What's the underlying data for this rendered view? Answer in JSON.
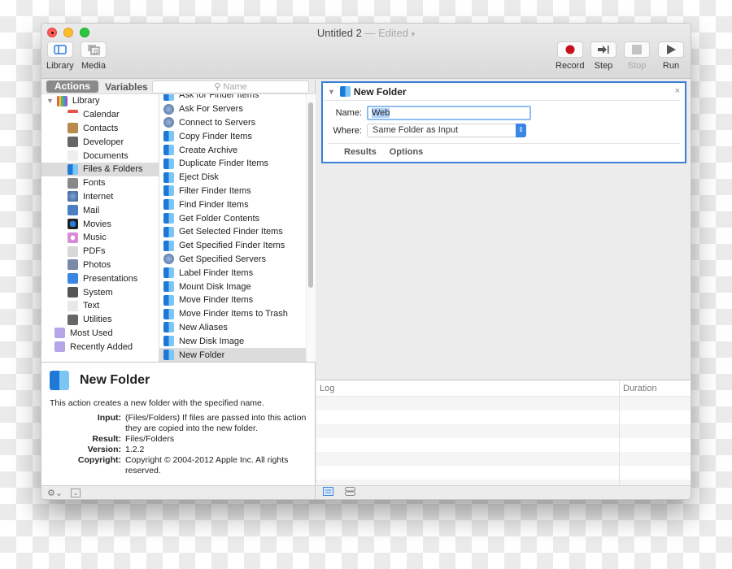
{
  "window": {
    "title": "Untitled 2",
    "title_separator": " — ",
    "title_status": "Edited",
    "title_chevron": "⌄"
  },
  "toolbar": {
    "library_label": "Library",
    "media_label": "Media",
    "record_label": "Record",
    "step_label": "Step",
    "stop_label": "Stop",
    "run_label": "Run",
    "colors": {
      "record": "#c8101c",
      "accent": "#3a7fd8"
    }
  },
  "tabs": {
    "actions": "Actions",
    "variables": "Variables"
  },
  "search": {
    "placeholder": "Name",
    "icon": "magnifier-icon"
  },
  "library": {
    "root": "Library",
    "items": [
      {
        "label": "Calendar",
        "icon": "calendar-icon"
      },
      {
        "label": "Contacts",
        "icon": "contacts-icon"
      },
      {
        "label": "Developer",
        "icon": "developer-icon"
      },
      {
        "label": "Documents",
        "icon": "documents-icon"
      },
      {
        "label": "Files & Folders",
        "icon": "finder-icon",
        "selected": true
      },
      {
        "label": "Fonts",
        "icon": "fonts-icon"
      },
      {
        "label": "Internet",
        "icon": "internet-icon"
      },
      {
        "label": "Mail",
        "icon": "mail-icon"
      },
      {
        "label": "Movies",
        "icon": "movies-icon"
      },
      {
        "label": "Music",
        "icon": "music-icon"
      },
      {
        "label": "PDFs",
        "icon": "pdf-icon"
      },
      {
        "label": "Photos",
        "icon": "photos-icon"
      },
      {
        "label": "Presentations",
        "icon": "presentations-icon"
      },
      {
        "label": "System",
        "icon": "system-icon"
      },
      {
        "label": "Text",
        "icon": "text-icon"
      },
      {
        "label": "Utilities",
        "icon": "utilities-icon"
      }
    ],
    "smart_groups": [
      {
        "label": "Most Used",
        "icon": "smart-folder-icon"
      },
      {
        "label": "Recently Added",
        "icon": "smart-folder-icon"
      }
    ]
  },
  "actions": [
    {
      "label": "Ask for Finder Items",
      "icon": "finder"
    },
    {
      "label": "Ask For Servers",
      "icon": "globe"
    },
    {
      "label": "Connect to Servers",
      "icon": "globe"
    },
    {
      "label": "Copy Finder Items",
      "icon": "finder"
    },
    {
      "label": "Create Archive",
      "icon": "finder"
    },
    {
      "label": "Duplicate Finder Items",
      "icon": "finder"
    },
    {
      "label": "Eject Disk",
      "icon": "finder"
    },
    {
      "label": "Filter Finder Items",
      "icon": "finder"
    },
    {
      "label": "Find Finder Items",
      "icon": "finder"
    },
    {
      "label": "Get Folder Contents",
      "icon": "finder"
    },
    {
      "label": "Get Selected Finder Items",
      "icon": "finder"
    },
    {
      "label": "Get Specified Finder Items",
      "icon": "finder"
    },
    {
      "label": "Get Specified Servers",
      "icon": "globe"
    },
    {
      "label": "Label Finder Items",
      "icon": "finder"
    },
    {
      "label": "Mount Disk Image",
      "icon": "finder"
    },
    {
      "label": "Move Finder Items",
      "icon": "finder"
    },
    {
      "label": "Move Finder Items to Trash",
      "icon": "finder"
    },
    {
      "label": "New Aliases",
      "icon": "finder"
    },
    {
      "label": "New Disk Image",
      "icon": "finder"
    },
    {
      "label": "New Folder",
      "icon": "finder",
      "selected": true
    }
  ],
  "description": {
    "title": "New Folder",
    "summary": "This action creates a new folder with the specified name.",
    "fields": [
      {
        "key": "Input:",
        "value": "(Files/Folders) If files are passed into this action they are copied into the new folder."
      },
      {
        "key": "Result:",
        "value": "Files/Folders"
      },
      {
        "key": "Version:",
        "value": "1.2.2"
      },
      {
        "key": "Copyright:",
        "value": "Copyright © 2004-2012 Apple Inc.  All rights reserved."
      }
    ]
  },
  "action_card": {
    "title": "New Folder",
    "close": "×",
    "name_label": "Name:",
    "name_value": "Web",
    "where_label": "Where:",
    "where_value": "Same Folder as Input",
    "results_label": "Results",
    "options_label": "Options"
  },
  "log": {
    "col_log": "Log",
    "col_duration": "Duration",
    "rows": 7
  }
}
